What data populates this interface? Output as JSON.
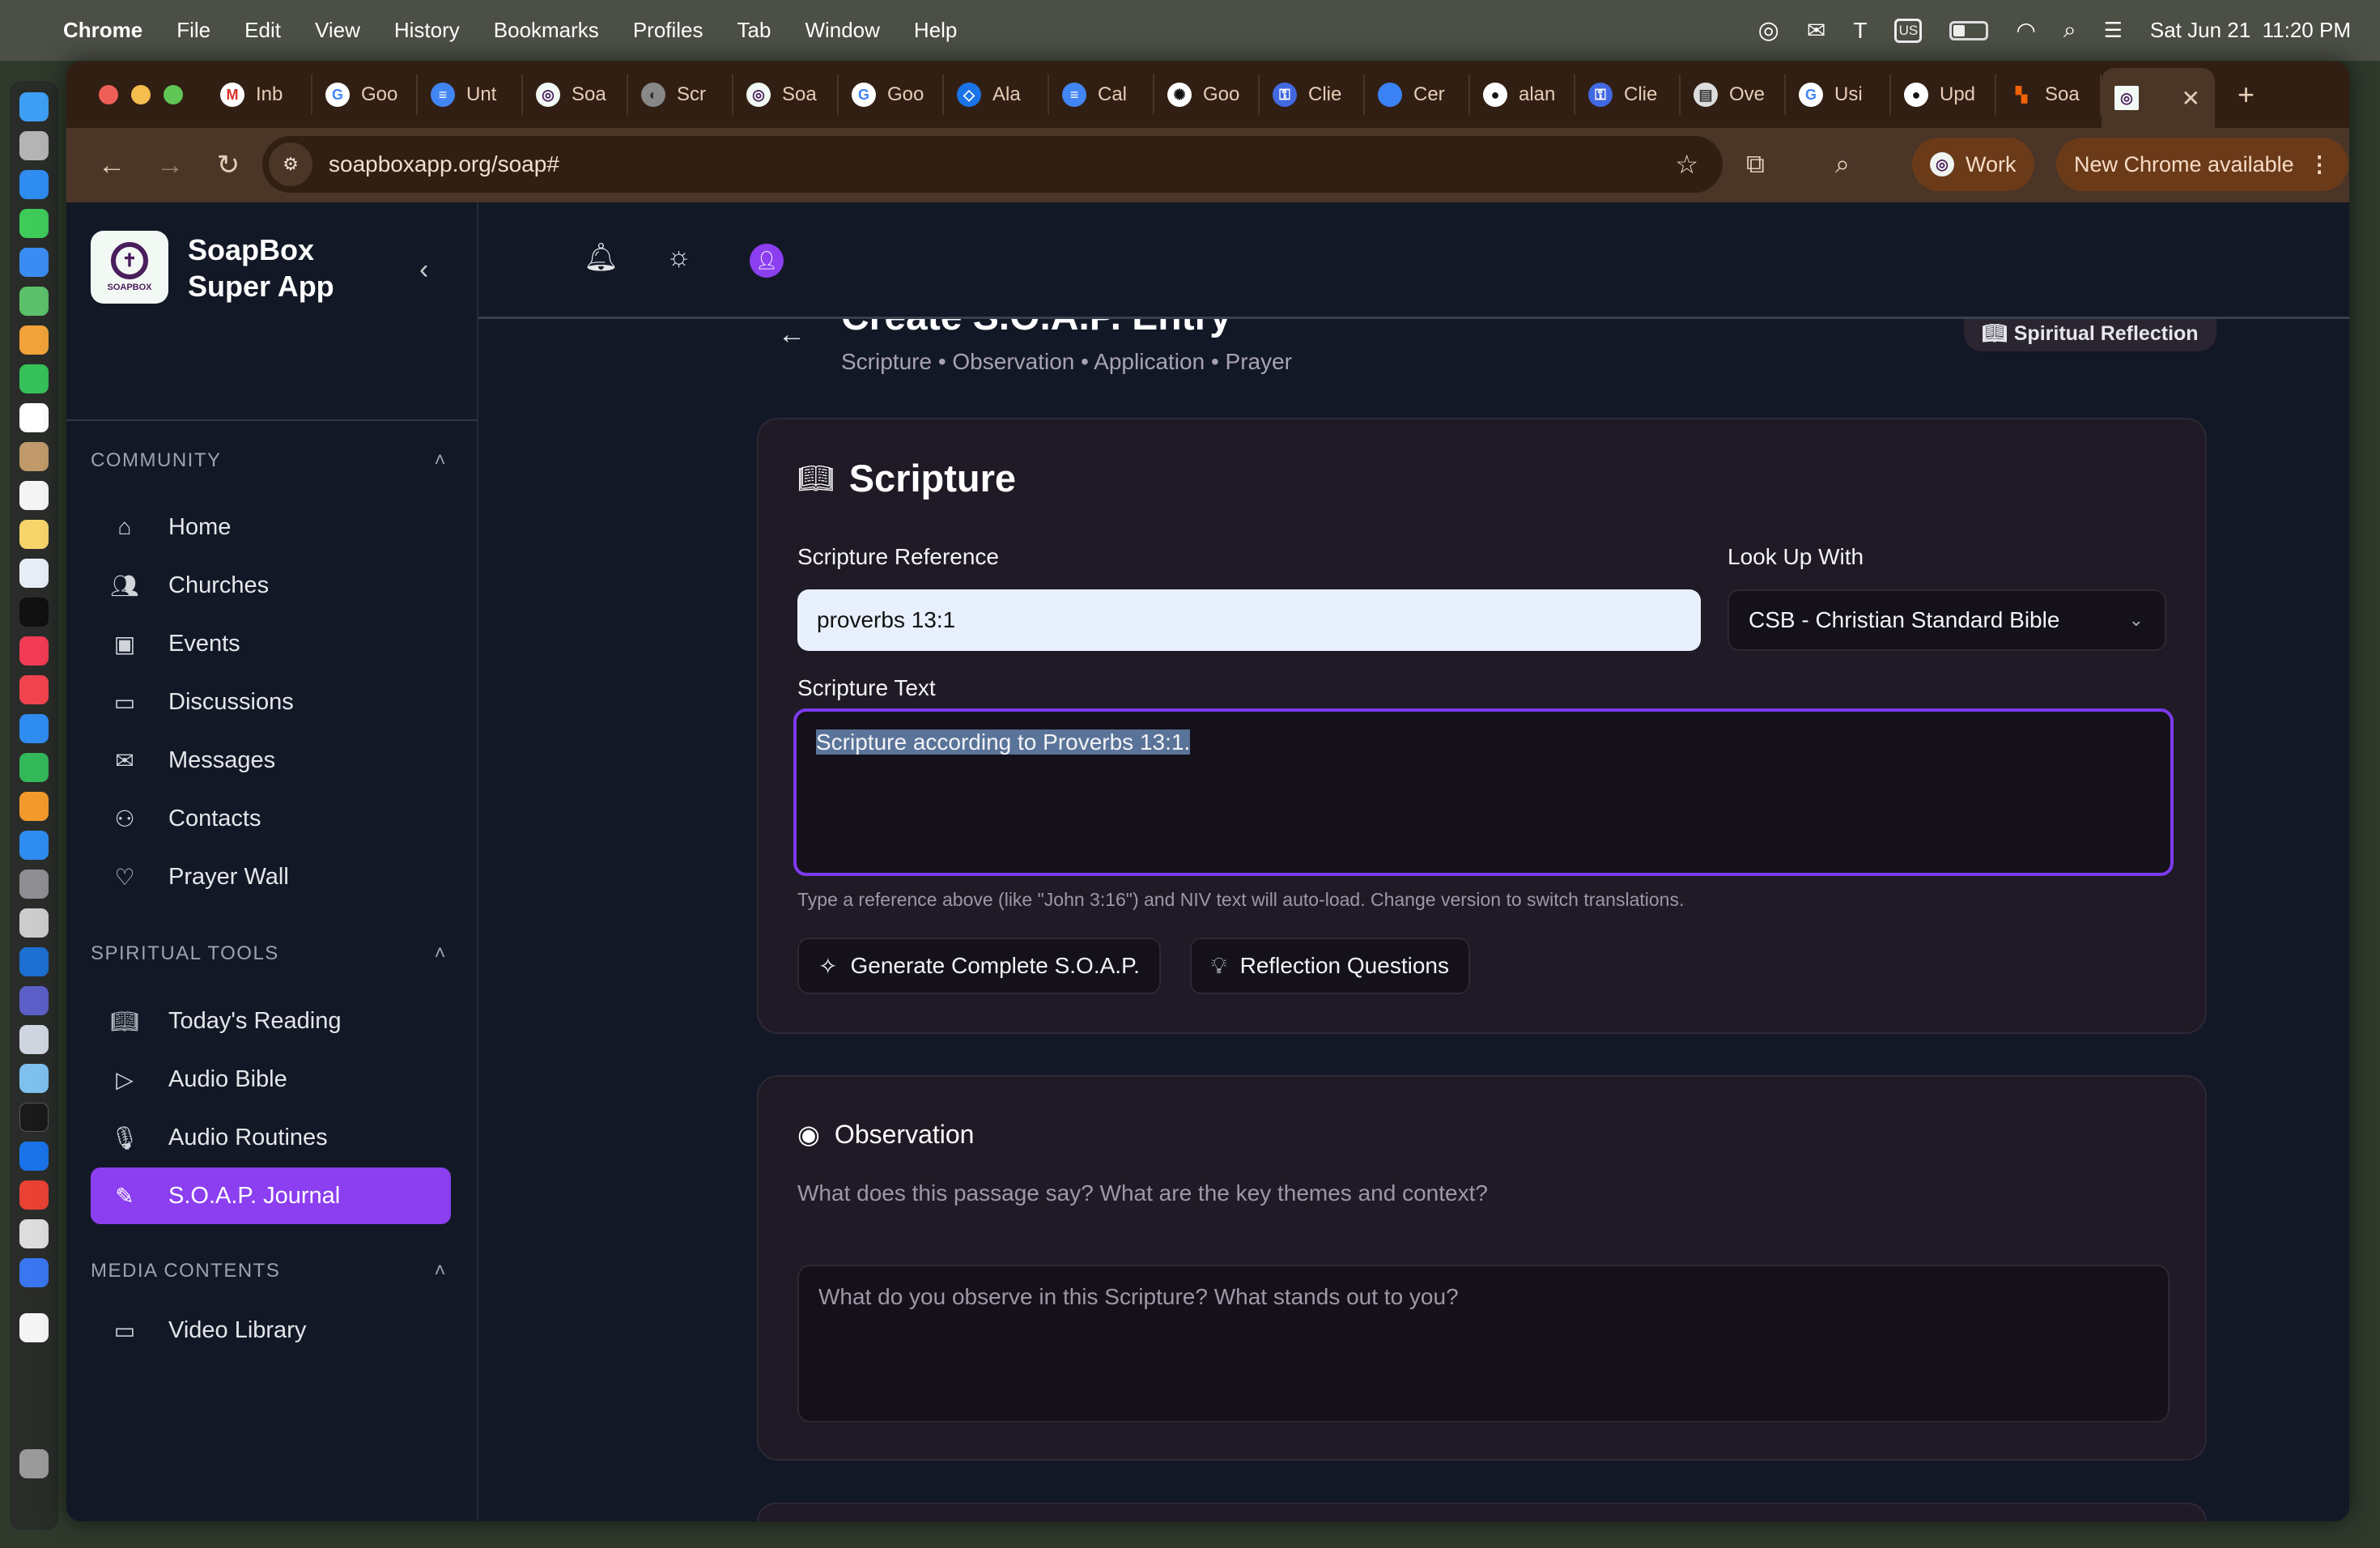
{
  "menubar": {
    "app": "Chrome",
    "items": [
      "File",
      "Edit",
      "View",
      "History",
      "Bookmarks",
      "Profiles",
      "Tab",
      "Window",
      "Help"
    ],
    "keyboard": "US",
    "datetime": "Sat Jun 21  11:20 PM"
  },
  "browser": {
    "tabs": [
      {
        "title": "Inb",
        "icon": "gmail-icon"
      },
      {
        "title": "Goo",
        "icon": "google-icon"
      },
      {
        "title": "Unt",
        "icon": "docs-icon"
      },
      {
        "title": "Soa",
        "icon": "soapbox-icon"
      },
      {
        "title": "Scr",
        "icon": "globe-icon"
      },
      {
        "title": "Soa",
        "icon": "soapbox-icon"
      },
      {
        "title": "Goo",
        "icon": "google-icon"
      },
      {
        "title": "Ala",
        "icon": "cloud-icon"
      },
      {
        "title": "Cal",
        "icon": "docs-icon"
      },
      {
        "title": "Goo",
        "icon": "openai-icon"
      },
      {
        "title": "Clie",
        "icon": "shield-icon"
      },
      {
        "title": "Cer",
        "icon": "apple-icon"
      },
      {
        "title": "alan",
        "icon": "github-icon"
      },
      {
        "title": "Clie",
        "icon": "shield-icon"
      },
      {
        "title": "Ove",
        "icon": "store-icon"
      },
      {
        "title": "Usi",
        "icon": "google-icon"
      },
      {
        "title": "Upd",
        "icon": "github-icon"
      },
      {
        "title": "Soa",
        "icon": "replit-icon"
      }
    ],
    "url": "soapboxapp.org/soap#",
    "profile": "Work",
    "update": "New Chrome available"
  },
  "sidebar": {
    "brand_line1": "SoapBox",
    "brand_line2": "Super App",
    "logo_text": "SOAPBOX",
    "sections": [
      {
        "title": "COMMUNITY",
        "items": [
          {
            "label": "Home",
            "icon": "home-icon"
          },
          {
            "label": "Churches",
            "icon": "users-icon"
          },
          {
            "label": "Events",
            "icon": "calendar-icon"
          },
          {
            "label": "Discussions",
            "icon": "message-square-icon"
          },
          {
            "label": "Messages",
            "icon": "mail-icon"
          },
          {
            "label": "Contacts",
            "icon": "user-plus-icon"
          },
          {
            "label": "Prayer Wall",
            "icon": "heart-icon"
          }
        ]
      },
      {
        "title": "SPIRITUAL TOOLS",
        "items": [
          {
            "label": "Today's Reading",
            "icon": "book-open-icon"
          },
          {
            "label": "Audio Bible",
            "icon": "play-icon"
          },
          {
            "label": "Audio Routines",
            "icon": "mic-icon"
          },
          {
            "label": "S.O.A.P. Journal",
            "icon": "pen-icon",
            "active": true
          }
        ]
      },
      {
        "title": "MEDIA CONTENTS",
        "items": [
          {
            "label": "Video Library",
            "icon": "video-icon"
          }
        ]
      }
    ]
  },
  "page": {
    "title": "Create S.O.A.P. Entry",
    "subtitle": "Scripture • Observation • Application • Prayer",
    "badge": "Spiritual Reflection",
    "accent": "#8b3ff0"
  },
  "scripture": {
    "heading": "Scripture",
    "reference_label": "Scripture Reference",
    "reference_value": "proverbs 13:1",
    "lookup_label": "Look Up With",
    "lookup_value": "CSB - Christian Standard Bible",
    "text_label": "Scripture Text",
    "text_value": "Scripture according to Proverbs 13:1.",
    "help": "Type a reference above (like \"John 3:16\") and NIV text will auto-load. Change version to switch translations.",
    "generate_button": "Generate Complete S.O.A.P.",
    "reflection_button": "Reflection Questions"
  },
  "observation": {
    "heading": "Observation",
    "description": "What does this passage say? What are the key themes and context?",
    "placeholder": "What do you observe in this Scripture? What stands out to you?"
  }
}
